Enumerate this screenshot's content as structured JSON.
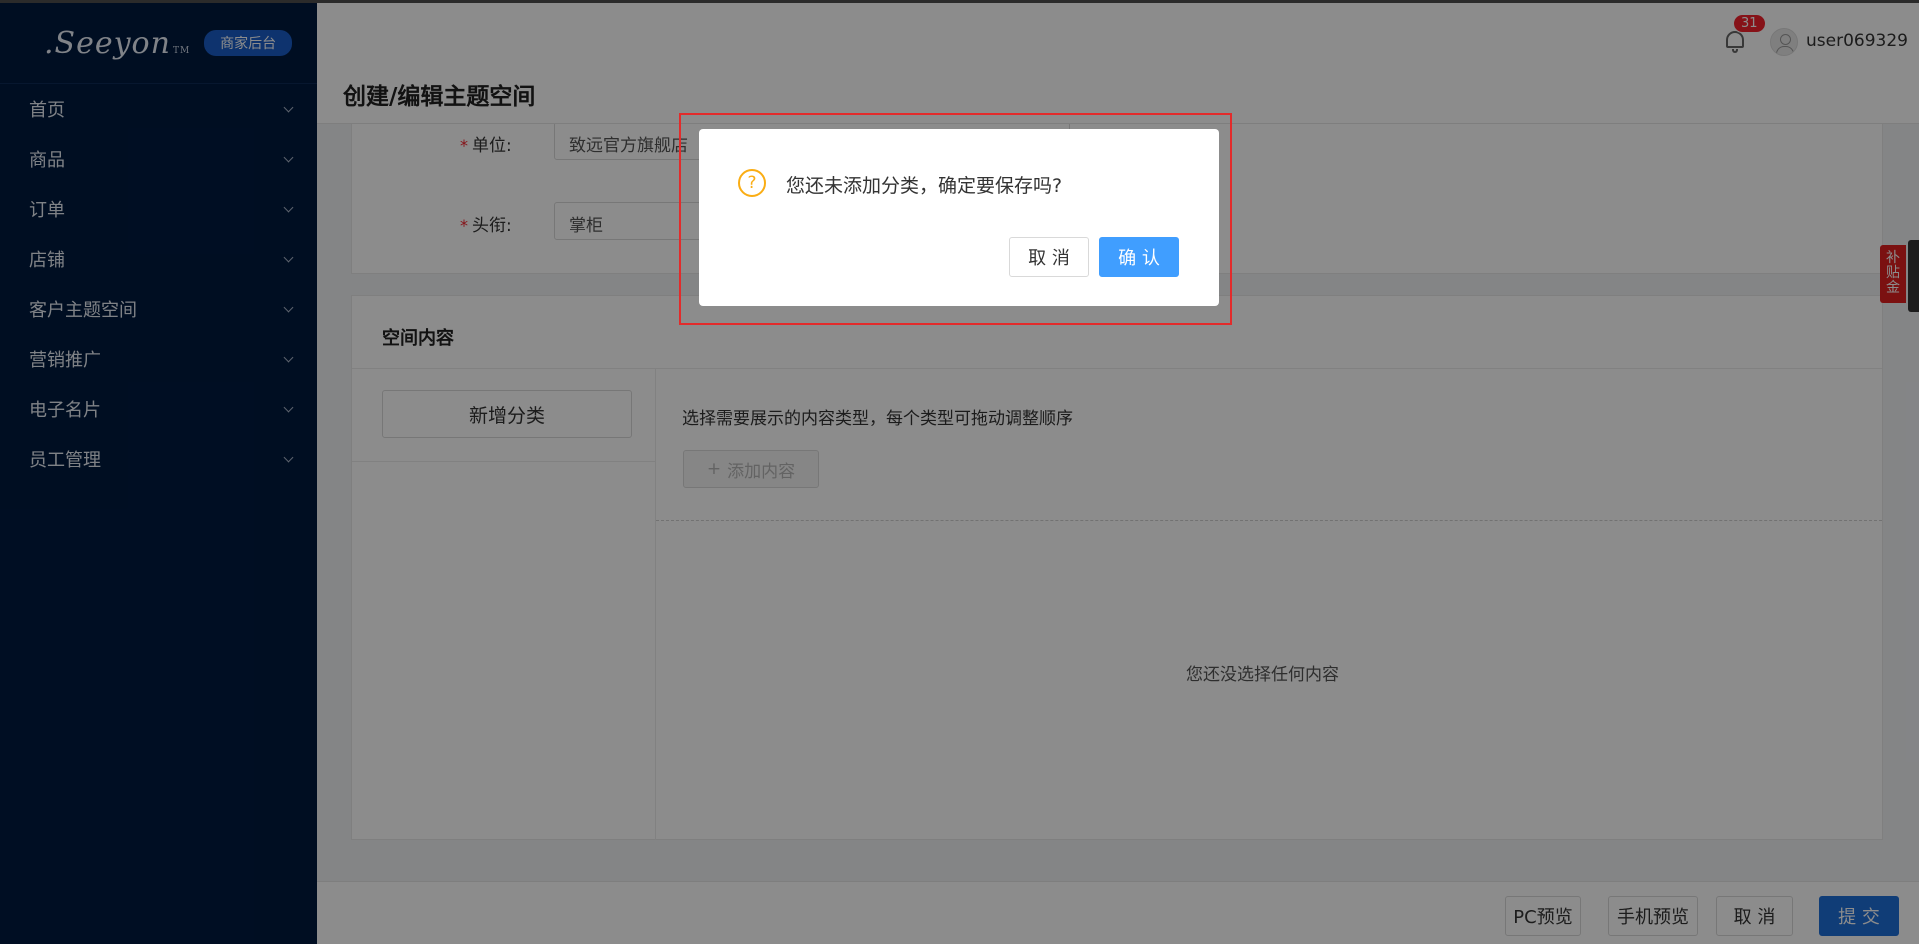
{
  "brand": {
    "logo_text": ".Seeyon",
    "logo_tm": "TM",
    "badge": "商家后台"
  },
  "sidebar": {
    "items": [
      {
        "label": "首页"
      },
      {
        "label": "商品"
      },
      {
        "label": "订单"
      },
      {
        "label": "店铺"
      },
      {
        "label": "客户主题空间"
      },
      {
        "label": "营销推广"
      },
      {
        "label": "电子名片"
      },
      {
        "label": "员工管理"
      }
    ]
  },
  "header": {
    "page_title": "创建/编辑主题空间",
    "notification_count": "31",
    "username": "user069329"
  },
  "form": {
    "required_mark": "*",
    "unit_label": "单位:",
    "unit_value": "致远官方旗舰店",
    "title_label": "头衔:",
    "title_value": "掌柜"
  },
  "space_content": {
    "section_title": "空间内容",
    "add_category_button": "新增分类",
    "hint": "选择需要展示的内容类型，每个类型可拖动调整顺序",
    "add_content_button": "添加内容",
    "add_content_icon": "+",
    "empty_text": "您还没选择任何内容"
  },
  "footer": {
    "pc_preview": "PC预览",
    "mobile_preview": "手机预览",
    "cancel": "取 消",
    "submit": "提 交"
  },
  "side_tab": {
    "label": "补贴金"
  },
  "dialog": {
    "icon": "?",
    "message": "您还未添加分类，确定要保存吗?",
    "cancel": "取 消",
    "confirm": "确 认"
  },
  "colors": {
    "sidebar_bg": "#001a3f",
    "primary": "#1e6fd9",
    "confirm": "#409eff",
    "warning": "#faad14",
    "highlight": "#e32b2b"
  }
}
